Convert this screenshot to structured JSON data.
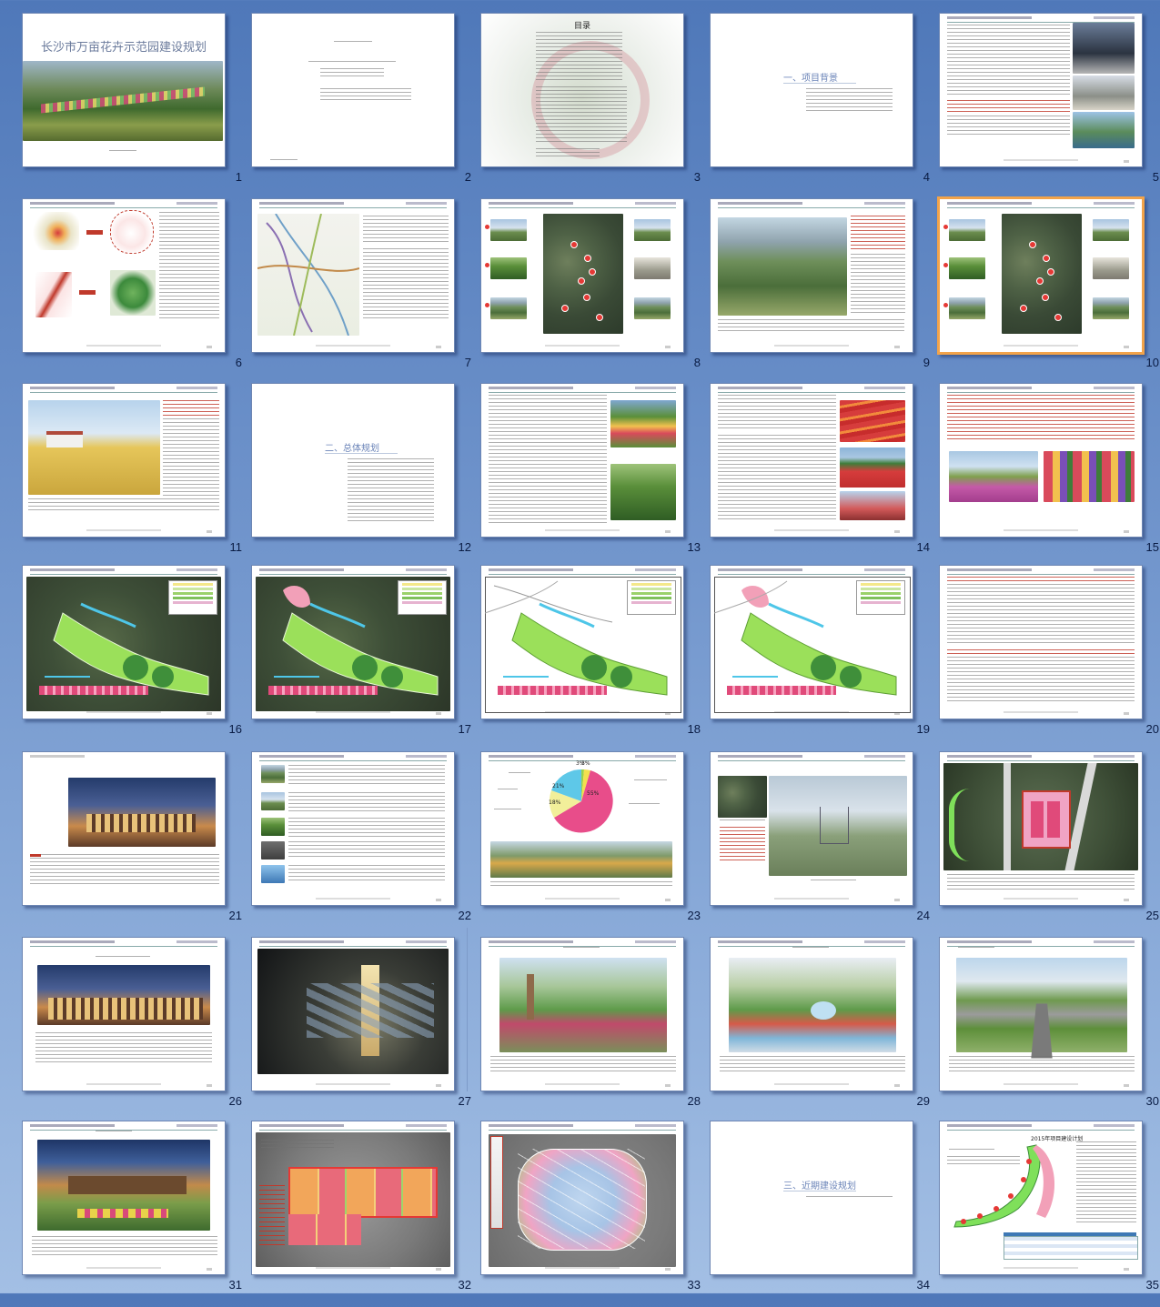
{
  "slides": [
    {
      "n": "1",
      "kind": "title",
      "title": "长沙市万亩花卉示范园建设规划"
    },
    {
      "n": "2",
      "kind": "credits"
    },
    {
      "n": "3",
      "kind": "toc",
      "title": "目录"
    },
    {
      "n": "4",
      "kind": "section",
      "title": "一、项目背景"
    },
    {
      "n": "5",
      "kind": "text-photos"
    },
    {
      "n": "6",
      "kind": "maps"
    },
    {
      "n": "7",
      "kind": "roadmap"
    },
    {
      "n": "8",
      "kind": "photomap"
    },
    {
      "n": "9",
      "kind": "landscape"
    },
    {
      "n": "10",
      "kind": "photomap",
      "selected": true
    },
    {
      "n": "11",
      "kind": "field"
    },
    {
      "n": "12",
      "kind": "section",
      "title": "二、总体规划"
    },
    {
      "n": "13",
      "kind": "text-flowers"
    },
    {
      "n": "14",
      "kind": "text-flowers2"
    },
    {
      "n": "15",
      "kind": "flowers-wide"
    },
    {
      "n": "16",
      "kind": "plan-dark"
    },
    {
      "n": "17",
      "kind": "plan-dark2"
    },
    {
      "n": "18",
      "kind": "plan-light"
    },
    {
      "n": "19",
      "kind": "plan-light2"
    },
    {
      "n": "20",
      "kind": "text-only"
    },
    {
      "n": "21",
      "kind": "building"
    },
    {
      "n": "22",
      "kind": "icons-list"
    },
    {
      "n": "23",
      "kind": "pie",
      "pie": [
        "21%",
        "18%",
        "55%",
        "3%",
        "3%"
      ]
    },
    {
      "n": "24",
      "kind": "site"
    },
    {
      "n": "25",
      "kind": "siteplan"
    },
    {
      "n": "26",
      "kind": "building2"
    },
    {
      "n": "27",
      "kind": "night"
    },
    {
      "n": "28",
      "kind": "render1"
    },
    {
      "n": "29",
      "kind": "render2"
    },
    {
      "n": "30",
      "kind": "render3"
    },
    {
      "n": "31",
      "kind": "render4"
    },
    {
      "n": "32",
      "kind": "grid-plan"
    },
    {
      "n": "33",
      "kind": "zone-plan"
    },
    {
      "n": "34",
      "kind": "section",
      "title": "三、近期建设规划"
    },
    {
      "n": "35",
      "kind": "map-table",
      "title": "2015年项目建设计划"
    }
  ]
}
